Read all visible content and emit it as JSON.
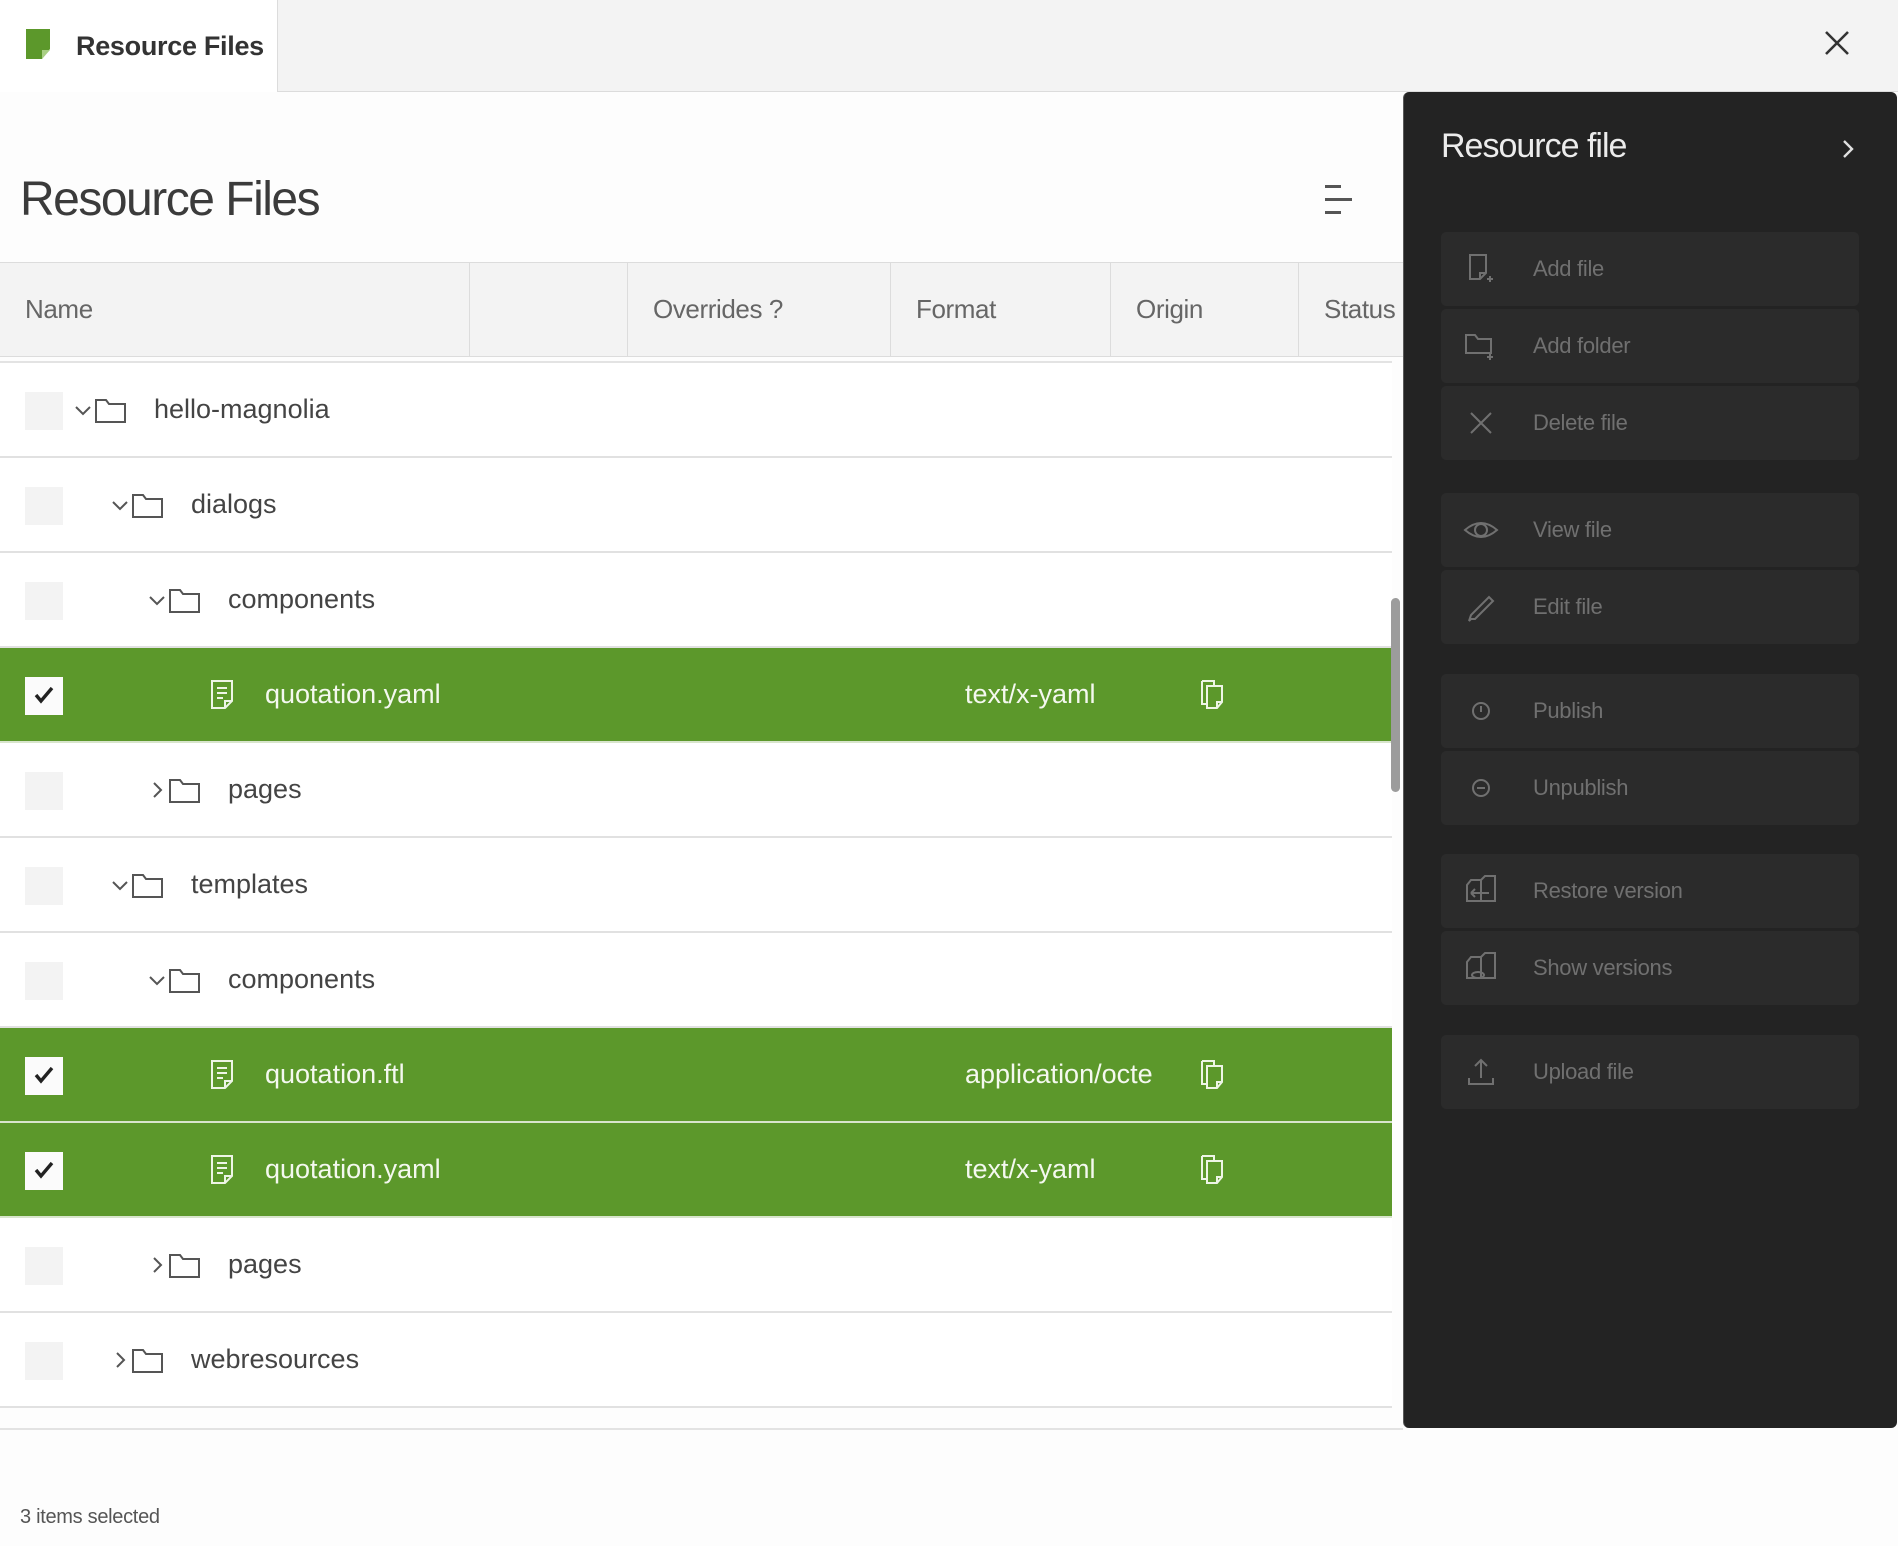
{
  "tab": {
    "label": "Resource Files",
    "icon": "resource-file-icon",
    "brand_color": "#5c982b"
  },
  "window": {
    "close_icon": "close-icon"
  },
  "main": {
    "title": "Resource Files",
    "column_menu_icon": "column-menu-icon"
  },
  "table": {
    "columns": [
      {
        "key": "name",
        "label": "Name"
      },
      {
        "key": "blank",
        "label": ""
      },
      {
        "key": "overrides",
        "label": "Overrides ?"
      },
      {
        "key": "format",
        "label": "Format"
      },
      {
        "key": "origin",
        "label": "Origin"
      },
      {
        "key": "status",
        "label": "Status"
      }
    ],
    "rows": [
      {
        "name": "hello-magnolia",
        "type": "folder",
        "depth": 0,
        "expanded": true,
        "selected": false,
        "format": "",
        "origin_icon": ""
      },
      {
        "name": "dialogs",
        "type": "folder",
        "depth": 1,
        "expanded": true,
        "selected": false,
        "format": "",
        "origin_icon": ""
      },
      {
        "name": "components",
        "type": "folder",
        "depth": 2,
        "expanded": true,
        "selected": false,
        "format": "",
        "origin_icon": ""
      },
      {
        "name": "quotation.yaml",
        "type": "file",
        "depth": 3,
        "expanded": false,
        "selected": true,
        "format": "text/x-yaml",
        "origin_icon": "copy-icon"
      },
      {
        "name": "pages",
        "type": "folder",
        "depth": 2,
        "expanded": false,
        "selected": false,
        "format": "",
        "origin_icon": ""
      },
      {
        "name": "templates",
        "type": "folder",
        "depth": 1,
        "expanded": true,
        "selected": false,
        "format": "",
        "origin_icon": ""
      },
      {
        "name": "components",
        "type": "folder",
        "depth": 2,
        "expanded": true,
        "selected": false,
        "format": "",
        "origin_icon": ""
      },
      {
        "name": "quotation.ftl",
        "type": "file",
        "depth": 3,
        "expanded": false,
        "selected": true,
        "format": "application/octe",
        "origin_icon": "copy-icon"
      },
      {
        "name": "quotation.yaml",
        "type": "file",
        "depth": 3,
        "expanded": false,
        "selected": true,
        "format": "text/x-yaml",
        "origin_icon": "copy-icon"
      },
      {
        "name": "pages",
        "type": "folder",
        "depth": 2,
        "expanded": false,
        "selected": false,
        "format": "",
        "origin_icon": ""
      },
      {
        "name": "webresources",
        "type": "folder",
        "depth": 1,
        "expanded": false,
        "selected": false,
        "format": "",
        "origin_icon": ""
      }
    ],
    "selection_color": "#5c982b"
  },
  "footer": {
    "status": "3 items selected"
  },
  "panel": {
    "title": "Resource file",
    "toggle_icon": "chevron-right-icon",
    "groups": [
      [
        {
          "label": "Add file",
          "icon": "add-file-icon"
        },
        {
          "label": "Add folder",
          "icon": "add-folder-icon"
        },
        {
          "label": "Delete file",
          "icon": "delete-icon"
        }
      ],
      [
        {
          "label": "View file",
          "icon": "eye-icon"
        },
        {
          "label": "Edit file",
          "icon": "pencil-icon"
        }
      ],
      [
        {
          "label": "Publish",
          "icon": "publish-icon"
        },
        {
          "label": "Unpublish",
          "icon": "unpublish-icon"
        }
      ],
      [
        {
          "label": "Restore version",
          "icon": "restore-version-icon"
        },
        {
          "label": "Show versions",
          "icon": "show-versions-icon"
        }
      ],
      [
        {
          "label": "Upload file",
          "icon": "upload-icon"
        }
      ]
    ]
  }
}
